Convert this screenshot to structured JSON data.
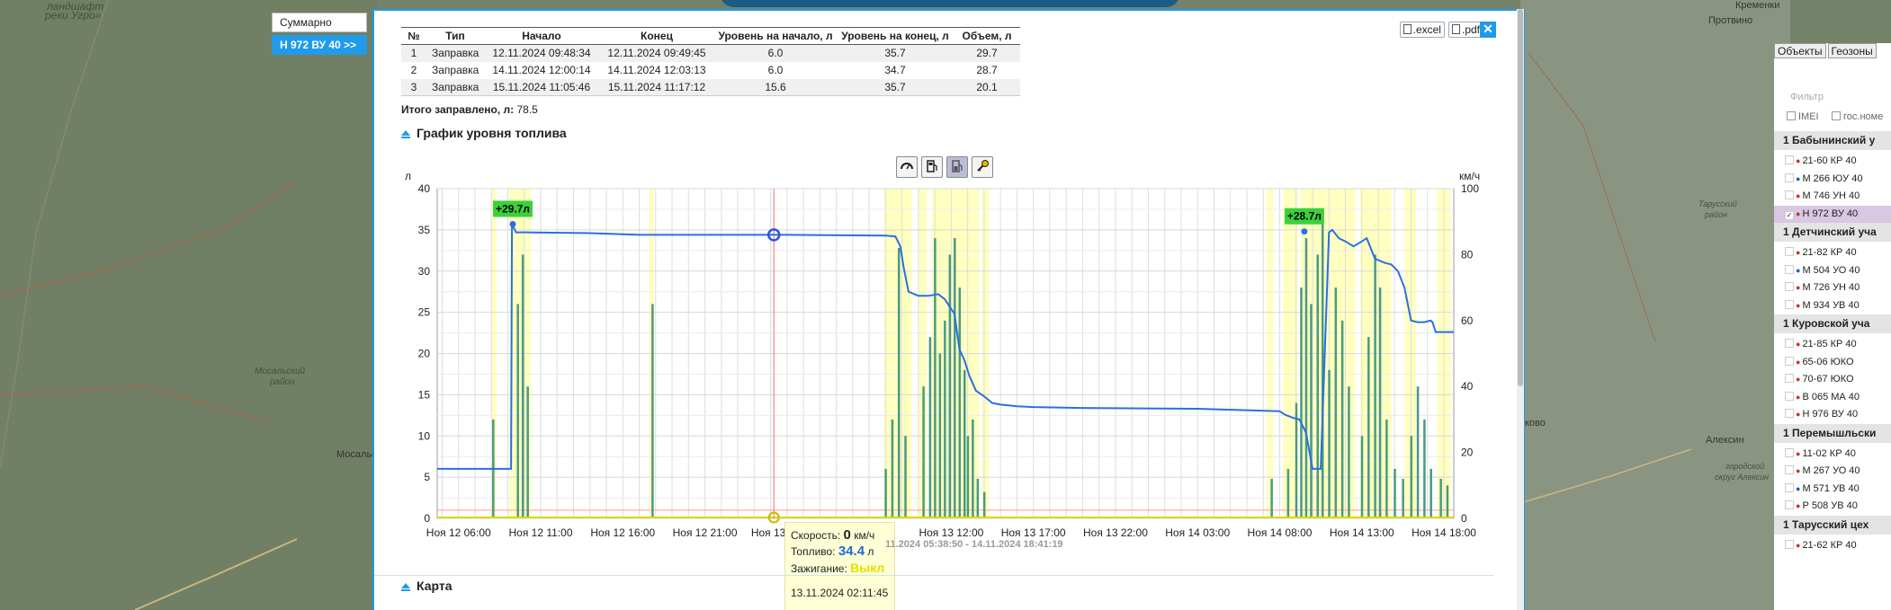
{
  "map": {
    "labels_italic": [
      "ландшафт",
      "реки Угро»",
      "Мосальский",
      "район",
      "Тарусский",
      "район",
      "городской",
      "округ Алексин"
    ],
    "labels": [
      "Мосальск",
      "Кременки",
      "Протвино",
      "Алексин",
      "ково"
    ]
  },
  "side_tabs": {
    "summary": "Суммарно",
    "vehicle_link": "Н 972 ВУ 40 >>"
  },
  "export": {
    "excel": ".excel",
    "pdf": ".pdf",
    "close": "✕"
  },
  "refuel_table": {
    "headers": [
      "№",
      "Тип",
      "Начало",
      "Конец",
      "Уровень на начало, л",
      "Уровень на конец, л",
      "Объем, л"
    ],
    "rows": [
      [
        "1",
        "Заправка",
        "12.11.2024 09:48:34",
        "12.11.2024 09:49:45",
        "6.0",
        "35.7",
        "29.7"
      ],
      [
        "2",
        "Заправка",
        "14.11.2024 12:00:14",
        "14.11.2024 12:03:13",
        "6.0",
        "34.7",
        "28.7"
      ],
      [
        "3",
        "Заправка",
        "15.11.2024 11:05:46",
        "15.11.2024 11:17:12",
        "15.6",
        "35.7",
        "20.1"
      ]
    ]
  },
  "total": {
    "label": "Итого заправлено, л:",
    "value": "78.5"
  },
  "sections": {
    "fuel_chart": "График уровня топлива",
    "map": "Карта"
  },
  "chart_toolbar": [
    "speedometer-icon",
    "fuel-pump-icon",
    "fuel-level-icon",
    "ignition-key-icon"
  ],
  "chart_data": {
    "type": "line",
    "ylabel": "л",
    "y2label": "км/ч",
    "ylim": [
      0,
      40
    ],
    "y2lim": [
      0,
      100
    ],
    "yticks": [
      "0",
      "5",
      "10",
      "15",
      "20",
      "25",
      "30",
      "35",
      "40"
    ],
    "y2ticks": [
      "0",
      "20",
      "40",
      "60",
      "80",
      "100"
    ],
    "x_ticks": [
      "Ноя 12 06:00",
      "Ноя 12 11:00",
      "Ноя 12 16:00",
      "Ноя 12 21:00",
      "Ноя 13 0",
      "3:00",
      "Ноя 13 12:00",
      "Ноя 13 17:00",
      "Ноя 13 22:00",
      "Ноя 14 03:00",
      "Ноя 14 08:00",
      "Ноя 14 13:00",
      "Ноя 14 18:00"
    ],
    "x_hours": [
      0,
      5,
      10,
      15,
      20,
      25,
      30,
      35,
      40,
      45,
      50,
      55,
      60
    ],
    "xlim": [
      -1.3,
      60.6
    ],
    "grid": true,
    "series": [
      {
        "name": "Топливо",
        "color": "#2a6ee6",
        "x": [
          -1.3,
          3.2,
          3.25,
          3.5,
          4.0,
          8.0,
          11.0,
          20.0,
          26.0,
          26.6,
          26.9,
          27.1,
          27.4,
          28.0,
          28.6,
          29.2,
          29.6,
          30.2,
          30.5,
          30.8,
          31.1,
          31.5,
          32.0,
          32.5,
          33.0,
          33.5,
          34.0,
          35.0,
          38.0,
          45.0,
          50.0,
          50.3,
          50.8,
          51.2,
          51.6,
          52.0,
          52.5,
          53.0,
          53.2,
          53.6,
          54.0,
          54.5,
          55.0,
          55.3,
          55.8,
          56.4,
          56.8,
          57.2,
          57.6,
          58.0,
          58.4,
          58.8,
          59.2,
          59.3,
          59.5,
          60.6
        ],
        "y": [
          6.0,
          6.0,
          35.7,
          34.7,
          34.7,
          34.6,
          34.4,
          34.4,
          34.3,
          34.2,
          33.0,
          30.5,
          27.5,
          27.0,
          27.0,
          27.2,
          26.6,
          24.8,
          20.5,
          19.2,
          17.3,
          15.5,
          14.8,
          14.0,
          13.8,
          13.7,
          13.6,
          13.5,
          13.4,
          13.3,
          13.0,
          12.6,
          12.2,
          12.0,
          10.4,
          6.0,
          6.0,
          34.7,
          35.0,
          34.0,
          33.6,
          33.0,
          33.6,
          34.0,
          31.5,
          31.0,
          30.8,
          30.0,
          28.0,
          24.0,
          23.8,
          23.8,
          24.0,
          23.8,
          22.6,
          22.6
        ]
      }
    ],
    "speed_spikes": [
      {
        "x": 3.6,
        "v": 65
      },
      {
        "x": 3.9,
        "v": 80
      },
      {
        "x": 4.2,
        "v": 40
      },
      {
        "x": 2.1,
        "v": 30
      },
      {
        "x": 11.8,
        "v": 65
      },
      {
        "x": 26.0,
        "v": 15
      },
      {
        "x": 26.4,
        "v": 30
      },
      {
        "x": 26.8,
        "v": 82
      },
      {
        "x": 27.2,
        "v": 25
      },
      {
        "x": 28.3,
        "v": 40
      },
      {
        "x": 28.7,
        "v": 55
      },
      {
        "x": 29.0,
        "v": 85
      },
      {
        "x": 29.3,
        "v": 50
      },
      {
        "x": 29.6,
        "v": 60
      },
      {
        "x": 29.9,
        "v": 80
      },
      {
        "x": 30.2,
        "v": 85
      },
      {
        "x": 30.5,
        "v": 70
      },
      {
        "x": 30.8,
        "v": 45
      },
      {
        "x": 31.0,
        "v": 25
      },
      {
        "x": 31.3,
        "v": 30
      },
      {
        "x": 31.6,
        "v": 12
      },
      {
        "x": 32.0,
        "v": 8
      },
      {
        "x": 49.5,
        "v": 12
      },
      {
        "x": 50.5,
        "v": 15
      },
      {
        "x": 51.0,
        "v": 35
      },
      {
        "x": 51.3,
        "v": 70
      },
      {
        "x": 51.6,
        "v": 85
      },
      {
        "x": 51.9,
        "v": 65
      },
      {
        "x": 52.3,
        "v": 80
      },
      {
        "x": 52.6,
        "v": 90
      },
      {
        "x": 53.0,
        "v": 45
      },
      {
        "x": 53.4,
        "v": 70
      },
      {
        "x": 53.8,
        "v": 60
      },
      {
        "x": 54.2,
        "v": 40
      },
      {
        "x": 55.0,
        "v": 25
      },
      {
        "x": 55.4,
        "v": 55
      },
      {
        "x": 55.8,
        "v": 80
      },
      {
        "x": 56.1,
        "v": 70
      },
      {
        "x": 56.5,
        "v": 30
      },
      {
        "x": 57.0,
        "v": 15
      },
      {
        "x": 57.5,
        "v": 12
      },
      {
        "x": 58.0,
        "v": 25
      },
      {
        "x": 58.4,
        "v": 40
      },
      {
        "x": 58.8,
        "v": 30
      },
      {
        "x": 59.2,
        "v": 15
      },
      {
        "x": 59.8,
        "v": 12
      },
      {
        "x": 60.2,
        "v": 10
      }
    ],
    "ignition_bands": [
      [
        2.0,
        2.3
      ],
      [
        3.1,
        4.4
      ],
      [
        11.6,
        11.9
      ],
      [
        25.9,
        27.6
      ],
      [
        28.0,
        28.5
      ],
      [
        28.8,
        31.7
      ],
      [
        31.9,
        32.3
      ],
      [
        49.2,
        49.6
      ],
      [
        50.2,
        51.1
      ],
      [
        51.3,
        54.6
      ],
      [
        54.9,
        56.8
      ],
      [
        57.6,
        58.3
      ],
      [
        59.6,
        60.4
      ]
    ],
    "annotations": [
      {
        "x": 3.3,
        "y": 35.7,
        "text": "+29.7л"
      },
      {
        "x": 51.5,
        "y": 34.8,
        "text": "+28.7л"
      }
    ],
    "cursor": {
      "x": 19.2,
      "y": 34.4
    }
  },
  "tooltip": {
    "speed_label": "Скорость:",
    "speed_value": "0",
    "speed_unit": "км/ч",
    "fuel_label": "Топливо:",
    "fuel_value": "34.4",
    "fuel_unit": "л",
    "ign_label": "Зажигание:",
    "ign_value": "Выкл",
    "time": "13.11.2024 02:11:45"
  },
  "range": "11.2024 05:38:50 - 14.11.2024 18:41:19",
  "right_panel": {
    "tabs": [
      "Объекты",
      "Геозоны"
    ],
    "filter_placeholder": "Фильтр",
    "imei": "IMEI",
    "gos_nomer": "гос.номе",
    "groups": [
      {
        "name": "1 Бабынинский у",
        "vehicles": [
          {
            "num": "21-60 КР 40",
            "color": "#c0392b"
          },
          {
            "num": "М 266 ЮУ 40",
            "color": "#1f5fcf"
          },
          {
            "num": "М 746 УН 40",
            "color": "#c0392b"
          },
          {
            "num": "Н 972 ВУ 40",
            "color": "#c0392b",
            "selected": true
          }
        ]
      },
      {
        "name": "1 Детчинский уча",
        "vehicles": [
          {
            "num": "21-82 КР 40",
            "color": "#c0392b"
          },
          {
            "num": "М 504 УО 40",
            "color": "#1f5fcf"
          },
          {
            "num": "М 726 УН 40",
            "color": "#c0392b"
          },
          {
            "num": "М 934 УВ 40",
            "color": "#c0392b"
          }
        ]
      },
      {
        "name": "1 Куровской уча",
        "vehicles": [
          {
            "num": "21-85 КР 40",
            "color": "#c0392b"
          },
          {
            "num": "65-06 ЮКО",
            "color": "#c0392b"
          },
          {
            "num": "70-67 ЮКО",
            "color": "#c0392b"
          },
          {
            "num": "В 065 МА 40",
            "color": "#c0392b"
          },
          {
            "num": "Н 976 ВУ 40",
            "color": "#c0392b"
          }
        ]
      },
      {
        "name": "1 Перемышльски",
        "vehicles": [
          {
            "num": "11-02 КР 40",
            "color": "#c0392b"
          },
          {
            "num": "М 267 УО 40",
            "color": "#c0392b"
          },
          {
            "num": "М 571 УВ 40",
            "color": "#1f5fcf"
          },
          {
            "num": "Р 508 УВ 40",
            "color": "#c0392b"
          }
        ]
      },
      {
        "name": "1 Тарусский цех",
        "vehicles": [
          {
            "num": "21-62 КР 40",
            "color": "#c0392b"
          }
        ]
      }
    ]
  }
}
